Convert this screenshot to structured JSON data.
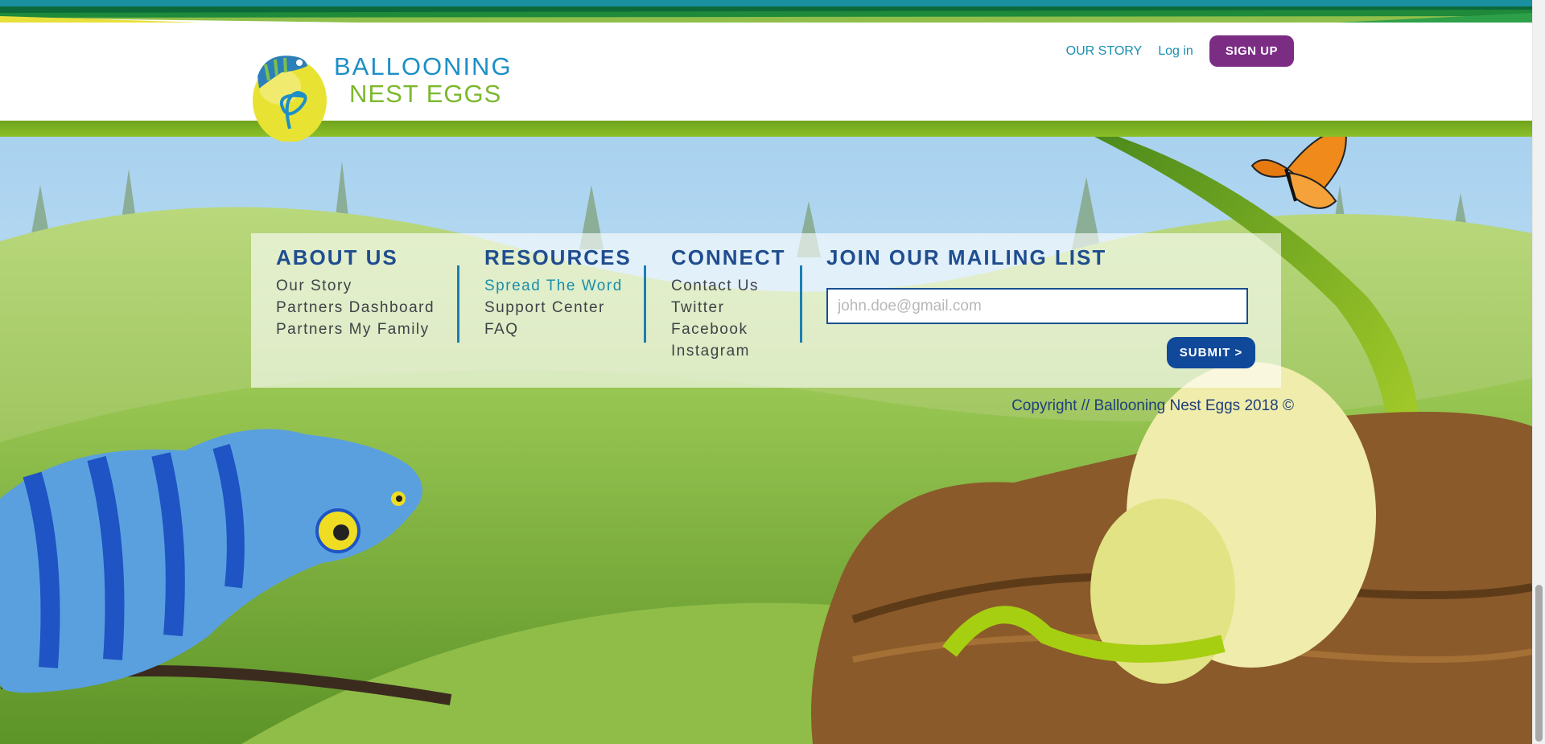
{
  "brand": {
    "line1": "BALLOONING",
    "line2": "NEST EGGS"
  },
  "nav": {
    "our_story": "OUR STORY",
    "login": "Log in",
    "signup": "SIGN UP"
  },
  "footer": {
    "about": {
      "heading": "ABOUT US",
      "links": [
        "Our Story",
        "Partners Dashboard",
        "Partners My Family"
      ]
    },
    "resources": {
      "heading": "RESOURCES",
      "links": [
        "Spread The Word",
        "Support Center",
        "FAQ"
      ]
    },
    "connect": {
      "heading": "CONNECT",
      "links": [
        "Contact Us",
        "Twitter",
        "Facebook",
        "Instagram"
      ]
    },
    "mailing": {
      "heading": "JOIN OUR MAILING LIST",
      "placeholder": "john.doe@gmail.com",
      "submit": "SUBMIT >"
    }
  },
  "copyright": "Copyright // Ballooning Nest Eggs 2018 ©",
  "colors": {
    "brand_blue": "#1e8fc6",
    "brand_green": "#7db82e",
    "signup_purple": "#7b2d84",
    "heading_navy": "#1f4d8f",
    "submit_blue": "#10489a"
  },
  "icons": [
    "chameleon-logo-icon",
    "butterfly-illustration",
    "chameleon-illustration",
    "nest-eggs-illustration"
  ]
}
